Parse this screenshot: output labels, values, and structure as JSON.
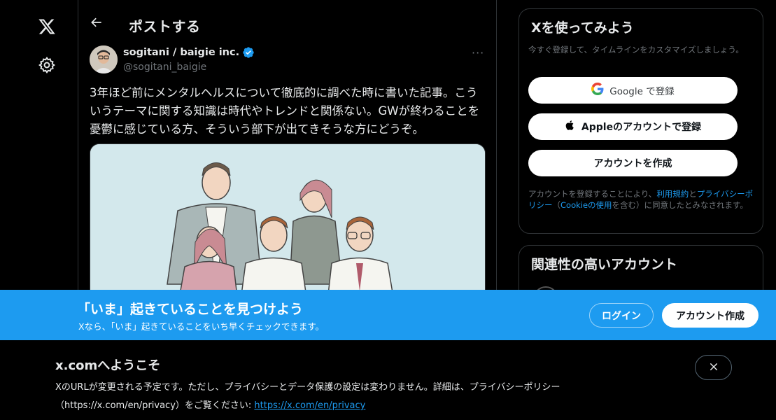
{
  "header": {
    "title": "ポストする"
  },
  "post": {
    "author_name": "sogitani / baigie inc.",
    "handle": "@sogitani_baigie",
    "text": "3年ほど前にメンタルヘルスについて徹底的に調べた時に書いた記事。こういうテーマに関する知識は時代やトレンドと関係ない。GWが終わることを憂鬱に感じている方、そういう部下が出てきそうな方にどうぞ。",
    "more": "···"
  },
  "signup": {
    "title": "Xを使ってみよう",
    "subtitle": "今すぐ登録して、タイムラインをカスタマイズしましょう。",
    "google_label": "Google で登録",
    "apple_label": "Appleのアカウントで登録",
    "create_label": "アカウントを作成",
    "terms_pre": "アカウントを登録することにより、",
    "terms_link": "利用規約",
    "terms_mid1": "と",
    "privacy_link": "プライバシーポリシー",
    "terms_mid2": "（",
    "cookie_link": "Cookieの使用",
    "terms_post": "を含む）に同意したとみなされます。"
  },
  "related": {
    "title": "関連性の高いアカウント"
  },
  "banner": {
    "title": "「いま」起きていることを見つけよう",
    "subtitle": "Xなら、「いま」起きていることをいち早くチェックできます。",
    "login_label": "ログイン",
    "signup_label": "アカウント作成"
  },
  "notice": {
    "title": "x.comへようこそ",
    "body": "XのURLが変更される予定です。ただし、プライバシーとデータ保護の設定は変わりません。詳細は、プライバシーポリシー（https://x.com/en/privacy）をご覧ください: ",
    "link": "https://x.com/en/privacy"
  },
  "colors": {
    "accent": "#1d9bf0",
    "background": "#000000",
    "muted": "#71767b"
  }
}
